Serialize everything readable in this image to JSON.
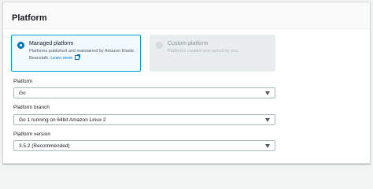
{
  "panel": {
    "title": "Platform"
  },
  "platform_type": {
    "managed": {
      "title": "Managed platform",
      "description": "Platforms published and maintained by Amazon Elastic Beanstalk.",
      "link": "Learn more",
      "selected": true
    },
    "custom": {
      "title": "Custom platform",
      "description": "Platforms created and owned by you.",
      "disabled": true
    }
  },
  "fields": {
    "platform": {
      "label": "Platform",
      "value": "Go"
    },
    "branch": {
      "label": "Platform branch",
      "value": "Go 1 running on 64bit Amazon Linux 2"
    },
    "version": {
      "label": "Platform version",
      "value": "3.5.2 (Recommended)"
    }
  },
  "colors": {
    "accent": "#0073bb",
    "selected_border": "#00a1c9",
    "selected_bg": "#f1faff"
  }
}
